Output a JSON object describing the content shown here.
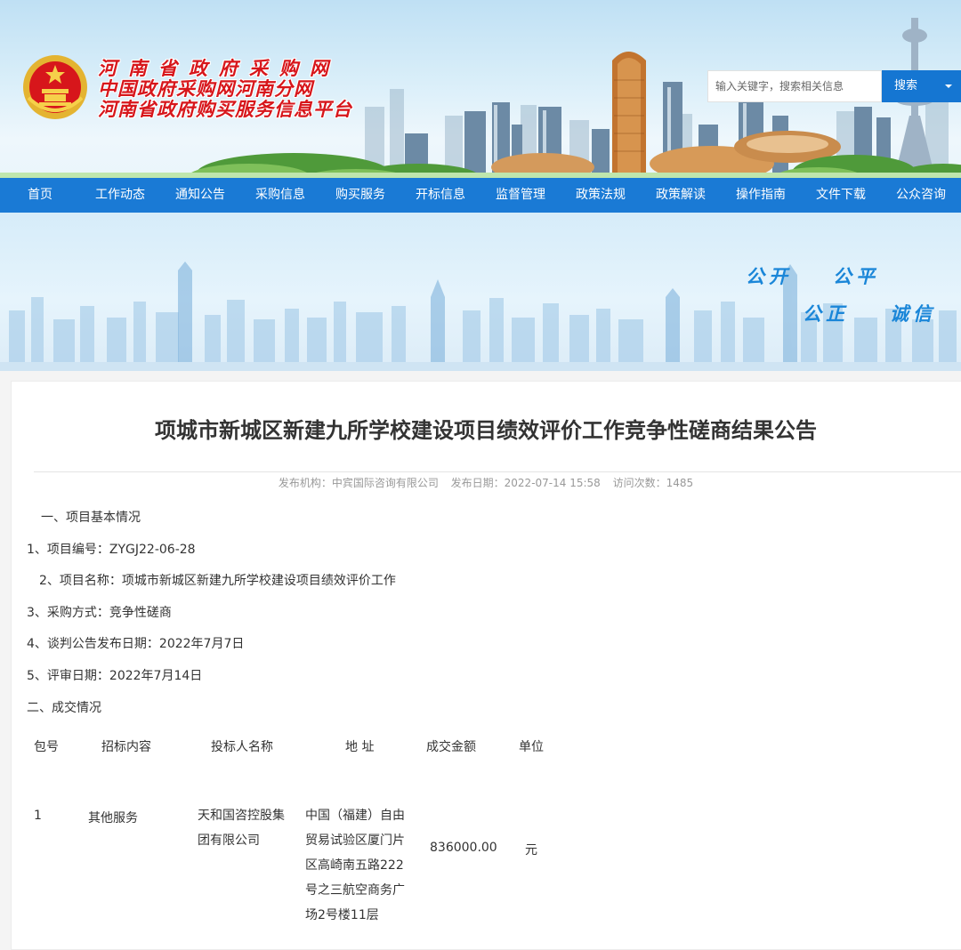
{
  "header": {
    "site_titles": [
      "河南省政府采购网",
      "中国政府采购网河南分网",
      "河南省政府购买服务信息平台"
    ],
    "search": {
      "placeholder": "输入关键字，搜索相关信息",
      "button": "搜索"
    }
  },
  "nav": [
    "首页",
    "工作动态",
    "通知公告",
    "采购信息",
    "购买服务",
    "开标信息",
    "监督管理",
    "政策法规",
    "政策解读",
    "操作指南",
    "文件下载",
    "公众咨询"
  ],
  "banner": {
    "slogans": [
      "公开",
      "公平",
      "公正",
      "诚信"
    ]
  },
  "article": {
    "title": "项城市新城区新建九所学校建设项目绩效评价工作竞争性磋商结果公告",
    "meta": {
      "publisher": "发布机构：中宾国际咨询有限公司",
      "date": "发布日期：2022-07-14 15:58",
      "views": "访问次数：1485"
    },
    "paragraphs": [
      "一、项目基本情况",
      "1、项目编号：ZYGJ22-06-28",
      "2、项目名称：项城市新城区新建九所学校建设项目绩效评价工作",
      "3、采购方式：竞争性磋商",
      "4、谈判公告发布日期：2022年7月7日",
      "5、评审日期：2022年7月14日",
      "二、成交情况"
    ],
    "table": {
      "headers": [
        "包号",
        "招标内容",
        "投标人名称",
        "地 址",
        "成交金额",
        "单位"
      ],
      "rows": [
        [
          "1",
          "其他服务",
          "天和国咨控股集团有限公司",
          "中国（福建）自由贸易试验区厦门片区高崎南五路222号之三航空商务广场2号楼11层",
          "836000.00",
          "元"
        ]
      ]
    }
  },
  "colors": {
    "nav": "#1a7ad5",
    "title_red": "#d7161b",
    "search_button": "#1576d2",
    "slogan": "#1a86d8"
  },
  "icons": [
    "national-emblem-icon",
    "dropdown-caret-icon"
  ]
}
